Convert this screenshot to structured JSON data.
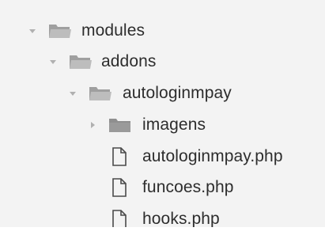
{
  "tree": {
    "items": [
      {
        "label": "modules",
        "type": "folder",
        "state": "expanded",
        "twisty_icon": "chevron-down-icon",
        "item_icon": "folder-open-icon"
      },
      {
        "label": "addons",
        "type": "folder",
        "state": "expanded",
        "twisty_icon": "chevron-down-icon",
        "item_icon": "folder-open-icon"
      },
      {
        "label": "autologinmpay",
        "type": "folder",
        "state": "expanded",
        "twisty_icon": "chevron-down-icon",
        "item_icon": "folder-open-icon"
      },
      {
        "label": "imagens",
        "type": "folder",
        "state": "collapsed",
        "twisty_icon": "chevron-right-icon",
        "item_icon": "folder-icon"
      },
      {
        "label": "autologinmpay.php",
        "type": "file",
        "item_icon": "file-icon"
      },
      {
        "label": "funcoes.php",
        "type": "file",
        "item_icon": "file-icon"
      },
      {
        "label": "hooks.php",
        "type": "file",
        "item_icon": "file-icon"
      }
    ]
  },
  "colors": {
    "background": "#f3f3f3",
    "text": "#2d2d2d",
    "twisty": "#a6a6a6",
    "folder_open": "#a3a3a3",
    "folder_closed": "#8f8f8f",
    "file_outline": "#4a4a4a"
  }
}
